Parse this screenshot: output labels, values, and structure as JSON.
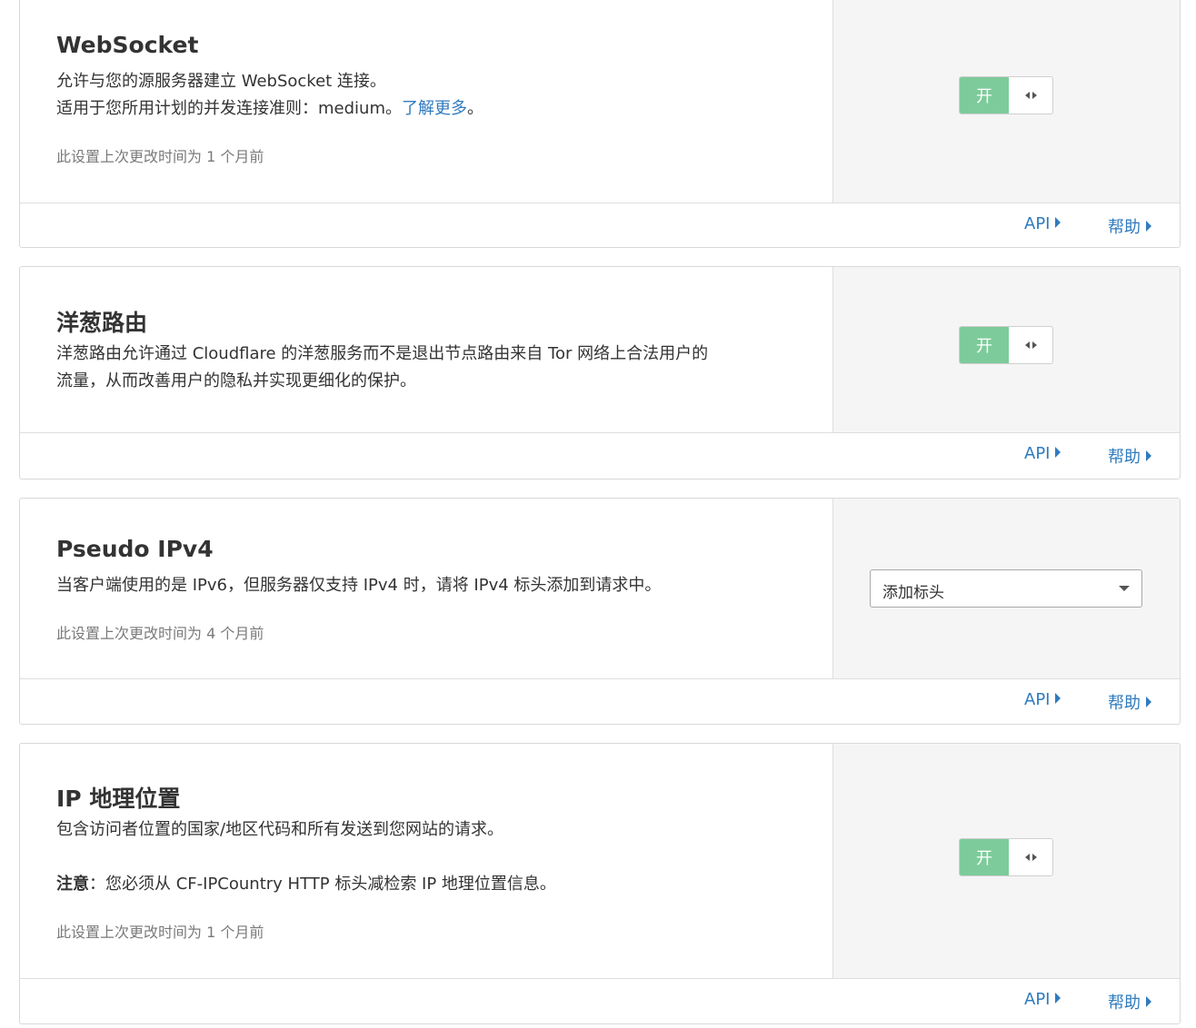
{
  "cards": [
    {
      "title": "WebSocket",
      "desc_line1": "允许与您的源服务器建立 WebSocket 连接。",
      "desc_line2_prefix": "适用于您所用计划的并发连接准则：medium。",
      "desc_link": "了解更多",
      "desc_line2_suffix": "。",
      "meta": "此设置上次更改时间为 1 个月前",
      "toggle_label": "开",
      "api_label": "API",
      "help_label": "帮助"
    },
    {
      "title": "洋葱路由",
      "desc_line1": "洋葱路由允许通过 Cloudflare 的洋葱服务而不是退出节点路由来自 Tor 网络上合法用户的",
      "desc_line2": "流量，从而改善用户的隐私并实现更细化的保护。",
      "toggle_label": "开",
      "api_label": "API",
      "help_label": "帮助"
    },
    {
      "title": "Pseudo IPv4",
      "desc_line1": "当客户端使用的是 IPv6，但服务器仅支持 IPv4 时，请将 IPv4 标头添加到请求中。",
      "meta": "此设置上次更改时间为 4 个月前",
      "select_value": "添加标头",
      "api_label": "API",
      "help_label": "帮助"
    },
    {
      "title": "IP 地理位置",
      "desc_line1": "包含访问者位置的国家/地区代码和所有发送到您网站的请求。",
      "note_label": "注意",
      "note_text": "：您必须从 CF-IPCountry HTTP 标头减检索 IP 地理位置信息。",
      "meta": "此设置上次更改时间为 1 个月前",
      "toggle_label": "开",
      "api_label": "API",
      "help_label": "帮助"
    }
  ],
  "colors": {
    "link": "#2f7bbf",
    "toggle_on": "#7dcb9a",
    "side_panel": "#f5f5f5",
    "border": "#d9d9d9"
  }
}
